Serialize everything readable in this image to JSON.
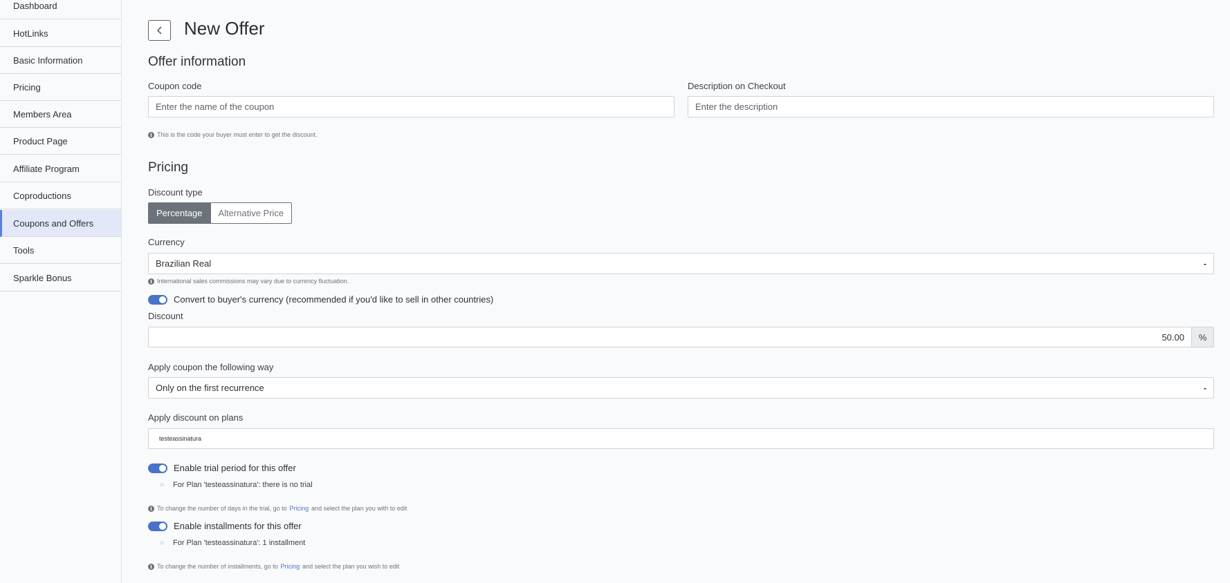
{
  "sidebar": {
    "items": [
      {
        "label": "Dashboard"
      },
      {
        "label": "HotLinks"
      },
      {
        "label": "Basic Information"
      },
      {
        "label": "Pricing"
      },
      {
        "label": "Members Area"
      },
      {
        "label": "Product Page"
      },
      {
        "label": "Affiliate Program"
      },
      {
        "label": "Coproductions"
      },
      {
        "label": "Coupons and Offers",
        "active": true
      },
      {
        "label": "Tools"
      },
      {
        "label": "Sparkle Bonus"
      }
    ]
  },
  "header": {
    "title": "New Offer",
    "back_icon": "chevron-left-icon"
  },
  "offer_info": {
    "section_title": "Offer information",
    "coupon_label": "Coupon code",
    "coupon_placeholder": "Enter the name of the coupon",
    "coupon_help": "This is the code your buyer must enter to get the discount.",
    "description_label": "Description on Checkout",
    "description_placeholder": "Enter the description"
  },
  "pricing": {
    "section_title": "Pricing",
    "discount_type_label": "Discount type",
    "discount_type_options": [
      "Percentage",
      "Alternative Price"
    ],
    "discount_type_selected": "Percentage",
    "currency_label": "Currency",
    "currency_value": "Brazilian Real",
    "currency_help": "International sales commissions may vary due to currency fluctuation.",
    "convert_toggle_label": "Convert to buyer's currency (recommended if you'd like to sell in other countries)",
    "convert_toggle_on": true,
    "discount_label": "Discount",
    "discount_value": "50.00",
    "discount_unit": "%",
    "apply_way_label": "Apply coupon the following way",
    "apply_way_value": "Only on the first recurrence",
    "plans_label": "Apply discount on plans",
    "plans_value": "testeassinatura",
    "trial_toggle_label": "Enable trial period for this offer",
    "trial_toggle_on": true,
    "trial_plan_note": "For Plan 'testeassinatura': there is no trial",
    "trial_help_prefix": "To change the number of days in the trial, go to",
    "trial_help_link": "Pricing",
    "trial_help_suffix": "and select the plan you with to edit",
    "installments_toggle_label": "Enable installments for this offer",
    "installments_toggle_on": true,
    "installments_plan_note": "For Plan 'testeassinatura': 1 installment",
    "installments_help_prefix": "To change the number of installments, go to",
    "installments_help_link": "Pricing",
    "installments_help_suffix": "and select the plan you wish to edit"
  },
  "colors": {
    "accent": "#4a72c9",
    "active_sidebar_bg": "#e2e8f7",
    "active_sidebar_border": "#5b7fde",
    "segment_active_bg": "#6c727a"
  }
}
